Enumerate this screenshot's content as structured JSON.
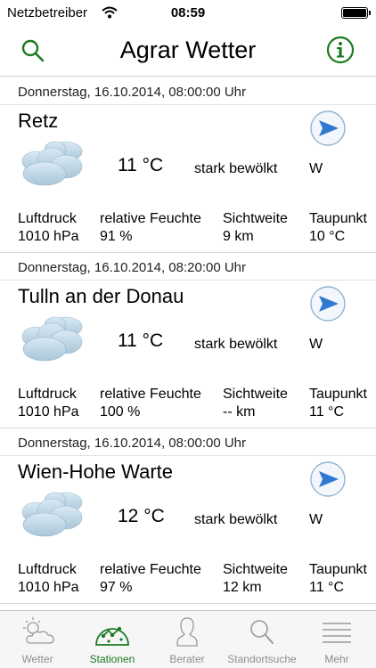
{
  "status_bar": {
    "carrier": "Netzbetreiber",
    "time": "08:59",
    "icons": [
      "wifi-icon",
      "battery-icon"
    ]
  },
  "nav": {
    "title": "Agrar Wetter",
    "left_icon": "search-icon",
    "right_icon": "info-icon",
    "accent_color": "#1a7a22"
  },
  "metric_labels": {
    "pressure": "Luftdruck",
    "humidity": "relative Feuchte",
    "visibility": "Sichtweite",
    "dewpoint": "Taupunkt"
  },
  "stations": [
    {
      "date": "Donnerstag, 16.10.2014, 08:00:00 Uhr",
      "name": "Retz",
      "temperature": "11 °C",
      "condition": "stark bewölkt",
      "wind_direction": "W",
      "pressure": "1010 hPa",
      "humidity": "91 %",
      "visibility": "9 km",
      "dewpoint": "10 °C",
      "weather_icon": "cloud-icon",
      "wind_icon": "wind-direction-arrow-icon"
    },
    {
      "date": "Donnerstag, 16.10.2014, 08:20:00 Uhr",
      "name": "Tulln an der Donau",
      "temperature": "11 °C",
      "condition": "stark bewölkt",
      "wind_direction": "W",
      "pressure": "1010 hPa",
      "humidity": "100 %",
      "visibility": "-- km",
      "dewpoint": "11 °C",
      "weather_icon": "cloud-icon",
      "wind_icon": "wind-direction-arrow-icon"
    },
    {
      "date": "Donnerstag, 16.10.2014, 08:00:00 Uhr",
      "name": "Wien-Hohe Warte",
      "temperature": "12 °C",
      "condition": "stark bewölkt",
      "wind_direction": "W",
      "pressure": "1010 hPa",
      "humidity": "97 %",
      "visibility": "12 km",
      "dewpoint": "11 °C",
      "weather_icon": "cloud-icon",
      "wind_icon": "wind-direction-arrow-icon"
    }
  ],
  "tabs": [
    {
      "label": "Wetter",
      "icon": "weather-icon",
      "active": false
    },
    {
      "label": "Stationen",
      "icon": "stations-icon",
      "active": true
    },
    {
      "label": "Berater",
      "icon": "advisor-icon",
      "active": false
    },
    {
      "label": "Standortsuche",
      "icon": "location-search-icon",
      "active": false
    },
    {
      "label": "Mehr",
      "icon": "more-icon",
      "active": false
    }
  ]
}
